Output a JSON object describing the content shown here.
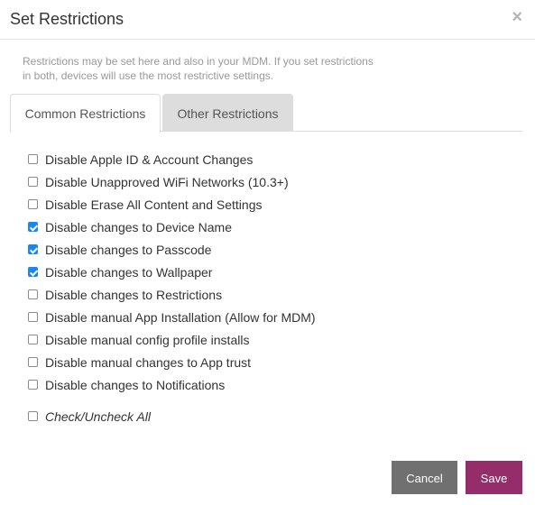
{
  "dialog": {
    "title": "Set Restrictions",
    "close_icon": "×",
    "intro_line1": "Restrictions may be set here and also in your MDM. If you set restrictions",
    "intro_line2": "in both, devices will use the most restrictive settings."
  },
  "tabs": [
    {
      "label": "Common Restrictions",
      "active": true
    },
    {
      "label": "Other Restrictions",
      "active": false
    }
  ],
  "restrictions": [
    {
      "label": "Disable Apple ID & Account Changes",
      "checked": false
    },
    {
      "label": "Disable Unapproved WiFi Networks (10.3+)",
      "checked": false
    },
    {
      "label": "Disable Erase All Content and Settings",
      "checked": false
    },
    {
      "label": "Disable changes to Device Name",
      "checked": true
    },
    {
      "label": "Disable changes to Passcode",
      "checked": true
    },
    {
      "label": "Disable changes to Wallpaper",
      "checked": true
    },
    {
      "label": "Disable changes to Restrictions",
      "checked": false
    },
    {
      "label": "Disable manual App Installation (Allow for MDM)",
      "checked": false
    },
    {
      "label": "Disable manual config profile installs",
      "checked": false
    },
    {
      "label": "Disable manual changes to App trust",
      "checked": false
    },
    {
      "label": "Disable changes to Notifications",
      "checked": false
    }
  ],
  "check_all": {
    "label": "Check/Uncheck All",
    "checked": false
  },
  "buttons": {
    "cancel": "Cancel",
    "save": "Save"
  },
  "colors": {
    "save": "#962d6b",
    "cancel": "#707070",
    "checkbox_checked": "#1a86f2"
  }
}
